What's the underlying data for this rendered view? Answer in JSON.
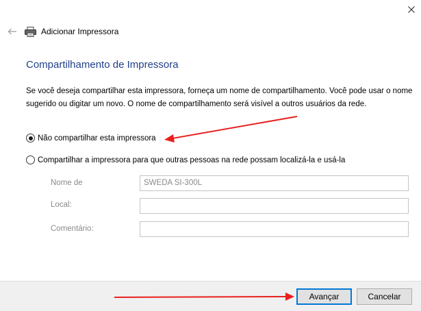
{
  "window": {
    "title": "Adicionar Impressora",
    "close_icon": "close-icon",
    "back_icon": "back-arrow-icon",
    "title_icon": "printer-icon"
  },
  "page": {
    "heading": "Compartilhamento de Impressora",
    "description": "Se você deseja compartilhar esta impressora, forneça um nome de compartilhamento. Você pode usar o nome sugerido ou digitar um novo. O nome de compartilhamento será visível a outros usuários da rede."
  },
  "options": {
    "no_share_label": "Não compartilhar esta impressora",
    "share_label": "Compartilhar a impressora para que outras pessoas na rede possam localizá-la e usá-la",
    "selected": "no_share"
  },
  "fields": {
    "share_name_label": "Nome de",
    "share_name_value": "SWEDA SI-300L",
    "location_label": "Local:",
    "location_value": "",
    "comment_label": "Comentário:",
    "comment_value": ""
  },
  "buttons": {
    "next_label": "Avançar",
    "cancel_label": "Cancelar"
  },
  "colors": {
    "heading": "#1f3f8a",
    "annotation_arrow": "#e8201e",
    "primary_border": "#0078d7"
  }
}
